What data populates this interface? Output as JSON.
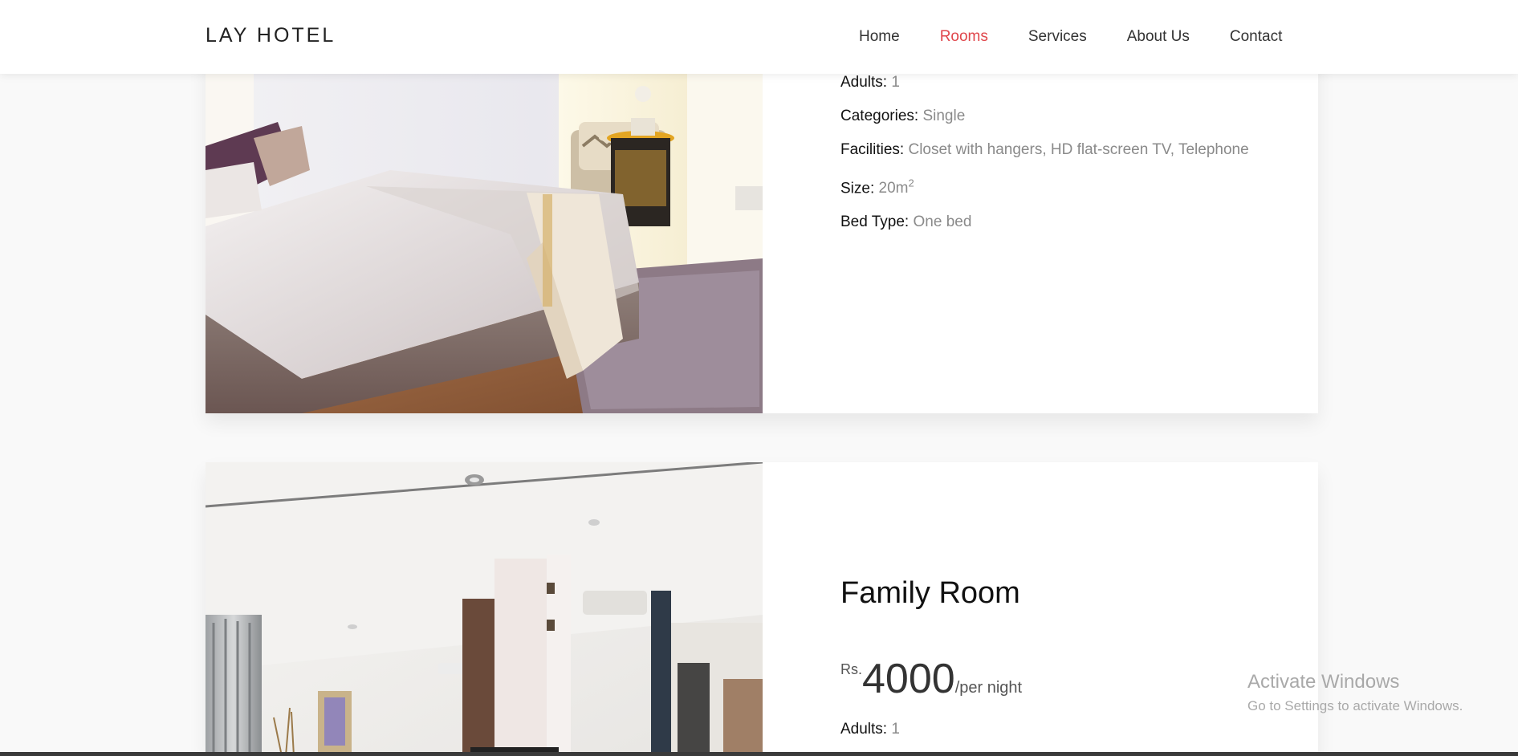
{
  "brand": "LAY HOTEL",
  "nav": [
    {
      "label": "Home",
      "active": false
    },
    {
      "label": "Rooms",
      "active": true
    },
    {
      "label": "Services",
      "active": false
    },
    {
      "label": "About Us",
      "active": false
    },
    {
      "label": "Contact",
      "active": false
    }
  ],
  "room1": {
    "adults_label": "Adults:",
    "adults": "1",
    "categories_label": "Categories:",
    "categories": "Single",
    "facilities_label": "Facilities:",
    "facilities": "Closet with hangers, HD flat-screen TV, Telephone",
    "size_label": "Size:",
    "size": "20m",
    "size_sup": "2",
    "bed_label": "Bed Type:",
    "bed": "One bed"
  },
  "room2": {
    "title": "Family Room",
    "currency": "Rs.",
    "price": "4000",
    "per": "/per night",
    "adults_label": "Adults:",
    "adults": "1"
  },
  "watermark": {
    "line1": "Activate Windows",
    "line2": "Go to Settings to activate Windows."
  },
  "colors": {
    "accent": "#e0474c",
    "background": "#f9f9f9"
  }
}
